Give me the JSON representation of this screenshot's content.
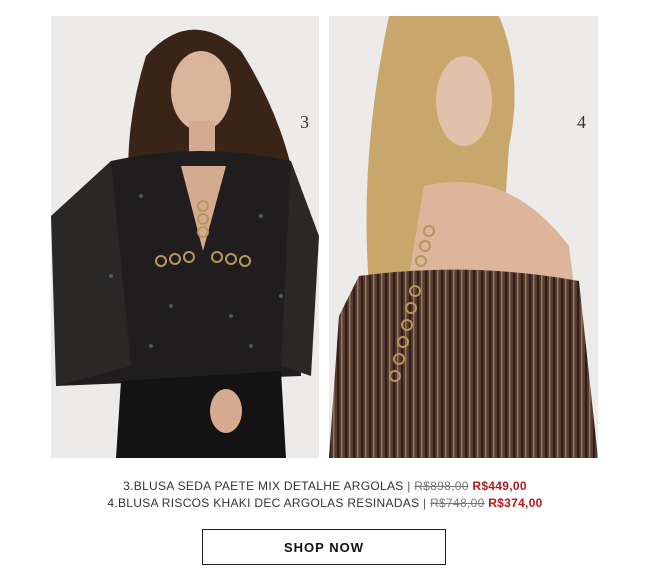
{
  "products": [
    {
      "number": "3",
      "image_alt": "Model wearing floral chiffon blouse with ring detail",
      "caption": "3.BLUSA SEDA PAETE MIX DETALHE ARGOLAS",
      "separator": "|",
      "old_price": "R$898,00",
      "new_price": "R$449,00"
    },
    {
      "number": "4",
      "image_alt": "Model wearing striped off-shoulder blouse with ring detail",
      "caption": "4.BLUSA RISCOS KHAKI DEC ARGOLAS RESINADAS",
      "separator": "|",
      "old_price": "R$748,00",
      "new_price": "R$374,00"
    }
  ],
  "cta": {
    "label": "SHOP NOW"
  },
  "colors": {
    "sale": "#b31b1b",
    "image_bg": "#ecebea"
  }
}
